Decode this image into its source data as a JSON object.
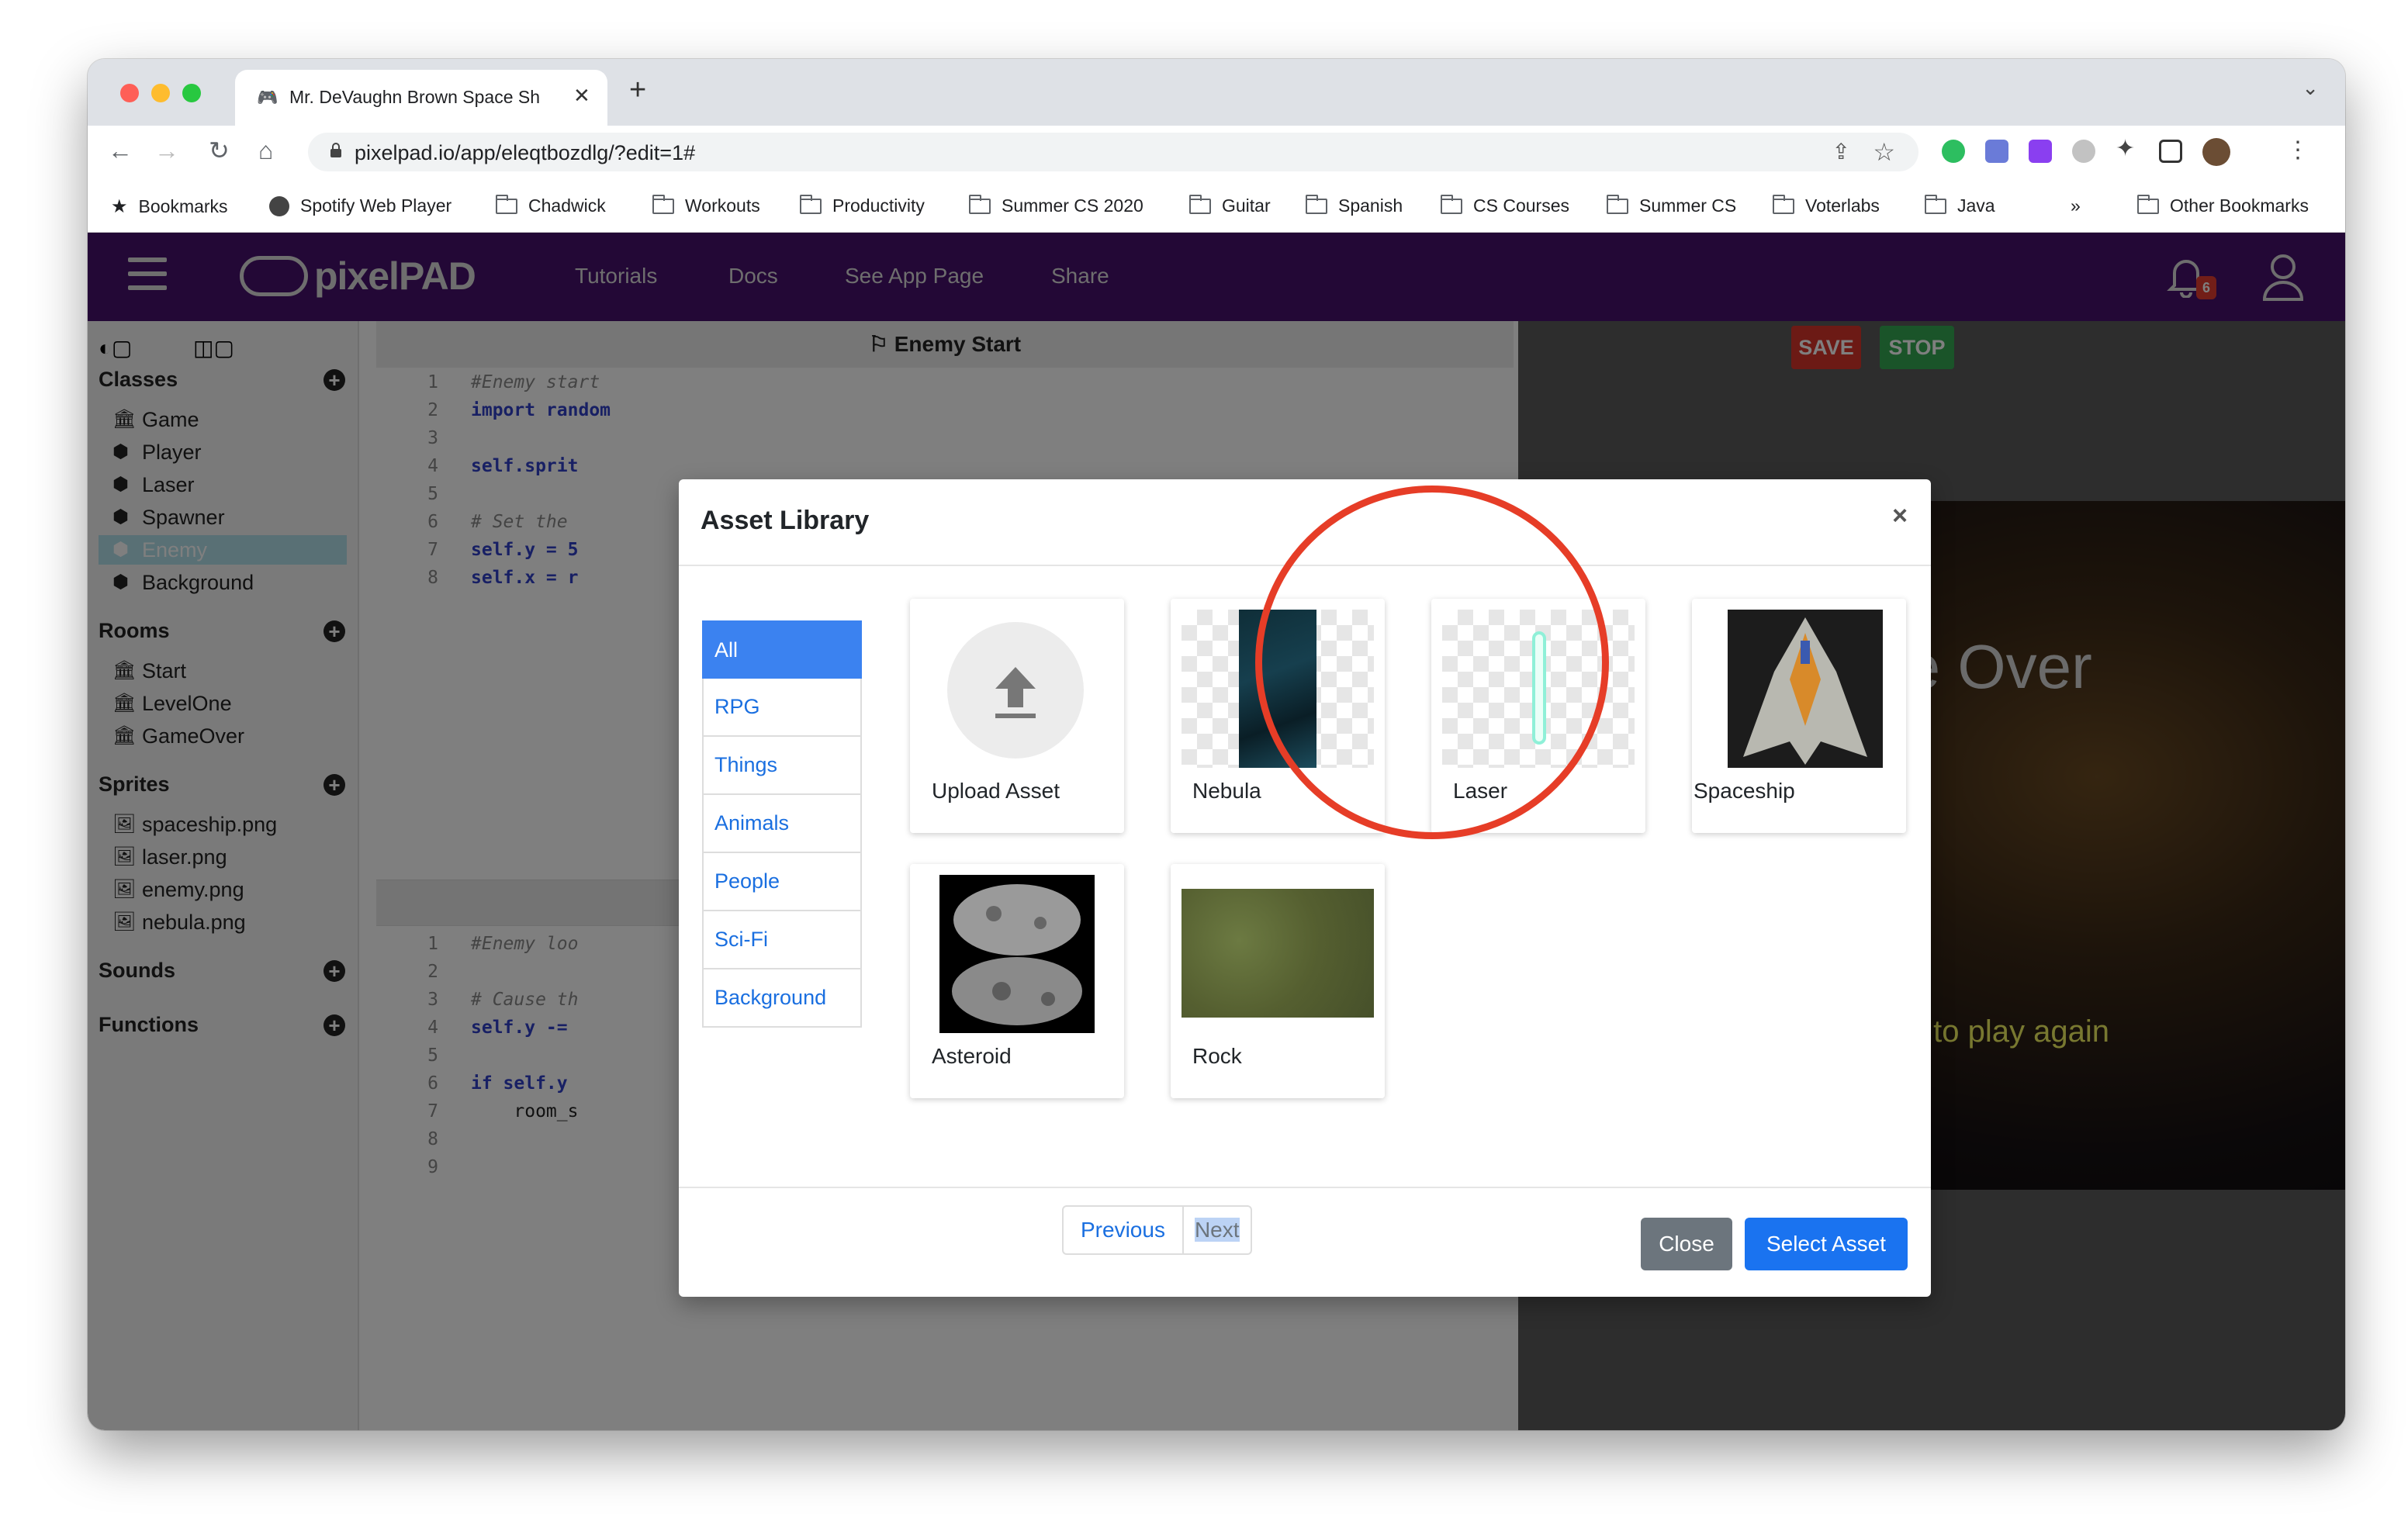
{
  "browser": {
    "tab_title": "Mr. DeVaughn Brown Space Sh",
    "url": "pixelpad.io/app/eleqtbozdlg/?edit=1#",
    "bookmarks": [
      "Bookmarks",
      "Spotify Web Player",
      "Chadwick",
      "Workouts",
      "Productivity",
      "Summer CS 2020",
      "Guitar",
      "Spanish",
      "CS Courses",
      "Summer CS",
      "Voterlabs",
      "Java"
    ],
    "overflow": "»",
    "other_bookmarks": "Other Bookmarks"
  },
  "nav": {
    "logo": "pixelPAD",
    "links": [
      "Tutorials",
      "Docs",
      "See App Page",
      "Share"
    ],
    "notification_count": "6"
  },
  "sidebar": {
    "sections": [
      {
        "title": "Classes",
        "items": [
          "Game",
          "Player",
          "Laser",
          "Spawner",
          "Enemy",
          "Background"
        ]
      },
      {
        "title": "Rooms",
        "items": [
          "Start",
          "LevelOne",
          "GameOver"
        ]
      },
      {
        "title": "Sprites",
        "items": [
          "spaceship.png",
          "laser.png",
          "enemy.png",
          "nebula.png"
        ]
      },
      {
        "title": "Sounds",
        "items": []
      },
      {
        "title": "Functions",
        "items": []
      }
    ],
    "selected": "Enemy"
  },
  "editor": {
    "title": "Enemy Start",
    "start_lines": [
      "#Enemy start",
      "import random",
      "",
      "self.sprit",
      "",
      "# Set the",
      "self.y = 5",
      "self.x = r"
    ],
    "loop_lines": [
      "#Enemy loo",
      "",
      "# Cause th",
      "self.y -=",
      "",
      "if self.y",
      "    room_s",
      "",
      ""
    ]
  },
  "preview": {
    "save": "SAVE",
    "stop": "STOP",
    "game_over": "Game Over",
    "press_again": "Press space to play again"
  },
  "modal": {
    "title": "Asset Library",
    "close_x": "×",
    "categories": [
      "All",
      "RPG",
      "Things",
      "Animals",
      "People",
      "Sci-Fi",
      "Background"
    ],
    "active_category": "All",
    "assets": [
      "Upload Asset",
      "Nebula",
      "Laser",
      "Spaceship",
      "Asteroid",
      "Rock"
    ],
    "previous": "Previous",
    "next": "Next",
    "close": "Close",
    "select": "Select Asset"
  },
  "colors": {
    "nav_bg": "#47106d",
    "primary": "#3b82f0",
    "save_red": "#d9342b",
    "stop_green": "#34a853",
    "annotation_circle": "#e63d27"
  }
}
